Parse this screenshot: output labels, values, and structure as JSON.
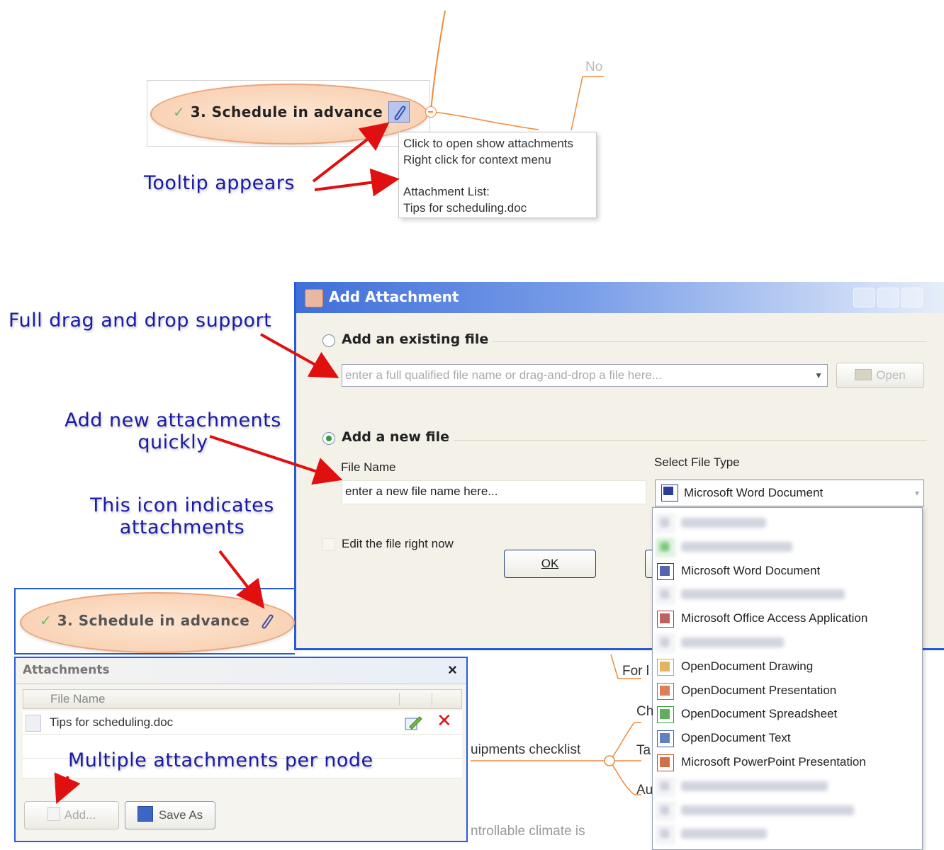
{
  "top_node": {
    "label": "3. Schedule in advance"
  },
  "map_fragments": {
    "top_no": "No",
    "for": "For l",
    "ch": "Ch",
    "ta": "Ta",
    "au": "Au",
    "equipments": "uipments checklist",
    "climate": "ntrollable climate is"
  },
  "tooltip": {
    "line1": "Click to open show attachments",
    "line2": "Right click for context menu",
    "line3": "Attachment List:",
    "line4": "Tips for scheduling.doc"
  },
  "callouts": {
    "tooltip_appears": "Tooltip appears",
    "drag_drop": "Full drag and drop support",
    "add_new_1": "Add new attachments",
    "add_new_2": "quickly",
    "icon_indicates_1": "This icon indicates",
    "icon_indicates_2": "attachments",
    "multiple": "Multiple attachments per node"
  },
  "dialog": {
    "title": "Add Attachment",
    "existing_label": "Add an existing file",
    "existing_placeholder": "enter a full qualified file name or drag-and-drop a file here...",
    "open_button": "Open",
    "new_label": "Add a new file",
    "file_name_label": "File Name",
    "file_name_placeholder": "enter a new file name here...",
    "select_type_label": "Select File Type",
    "selected_type": "Microsoft Word Document",
    "edit_now_label": "Edit the file right now",
    "ok_button": "OK",
    "existing_selected": false,
    "new_selected": true,
    "edit_now_checked": false
  },
  "file_types": [
    {
      "label": "",
      "icon": "blurred-icon",
      "blurred": true
    },
    {
      "label": "",
      "icon": "green-blurred-icon",
      "blurred": true
    },
    {
      "label": "Microsoft Word Document",
      "icon": "word-icon",
      "blurred": false
    },
    {
      "label": "",
      "icon": "blurred-icon",
      "blurred": true
    },
    {
      "label": "Microsoft Office Access Application",
      "icon": "access-icon",
      "blurred": false
    },
    {
      "label": "",
      "icon": "blurred-icon",
      "blurred": true
    },
    {
      "label": "OpenDocument Drawing",
      "icon": "odg-icon",
      "blurred": false
    },
    {
      "label": "OpenDocument Presentation",
      "icon": "odp-icon",
      "blurred": false
    },
    {
      "label": "OpenDocument Spreadsheet",
      "icon": "ods-icon",
      "blurred": false
    },
    {
      "label": "OpenDocument Text",
      "icon": "odt-icon",
      "blurred": false
    },
    {
      "label": "Microsoft PowerPoint Presentation",
      "icon": "ppt-icon",
      "blurred": false
    },
    {
      "label": "",
      "icon": "blurred-icon",
      "blurred": true
    },
    {
      "label": "",
      "icon": "blurred-icon",
      "blurred": true
    },
    {
      "label": "",
      "icon": "blurred-icon",
      "blurred": true
    }
  ],
  "bottom_node": {
    "label": "3. Schedule in advance"
  },
  "attachments_panel": {
    "title": "Attachments",
    "close": "×",
    "column_file_name": "File Name",
    "rows": [
      {
        "name": "Tips for scheduling.doc"
      }
    ],
    "add_button": "Add...",
    "save_as_button": "Save As"
  },
  "colors": {
    "callout_blue": "#1a1aa8",
    "node_fill": "#f9d3b6",
    "node_border": "#e9a37a",
    "dialog_border": "#2a5bd7",
    "arrow_red": "#e01010",
    "map_line": "#f08a3c"
  }
}
